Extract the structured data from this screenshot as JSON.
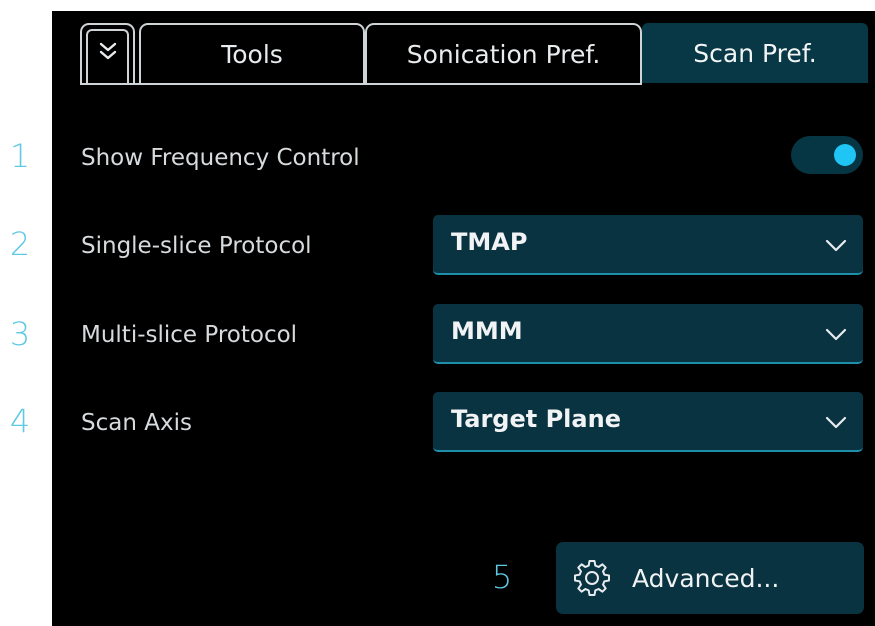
{
  "tabs": {
    "collapse_icon": "double-chevron-down-icon",
    "items": [
      {
        "label": "Tools",
        "selected": false
      },
      {
        "label": "Sonication Pref.",
        "selected": false
      },
      {
        "label": "Scan Pref.",
        "selected": true
      }
    ]
  },
  "callouts": [
    "1",
    "2",
    "3",
    "4",
    "5"
  ],
  "settings": {
    "show_frequency_control": {
      "label": "Show Frequency Control",
      "enabled": true
    },
    "single_slice_protocol": {
      "label": "Single-slice Protocol",
      "value": "TMAP"
    },
    "multi_slice_protocol": {
      "label": "Multi-slice Protocol",
      "value": "MMM"
    },
    "scan_axis": {
      "label": "Scan Axis",
      "value": "Target Plane"
    }
  },
  "advanced_button": {
    "label": "Advanced...",
    "icon": "gear-icon"
  },
  "colors": {
    "panel_background": "#000000",
    "selected_tab": "#083746",
    "control_background": "#0a3341",
    "toggle_knob": "#1ec5f5",
    "callout": "#5ec9e3"
  }
}
